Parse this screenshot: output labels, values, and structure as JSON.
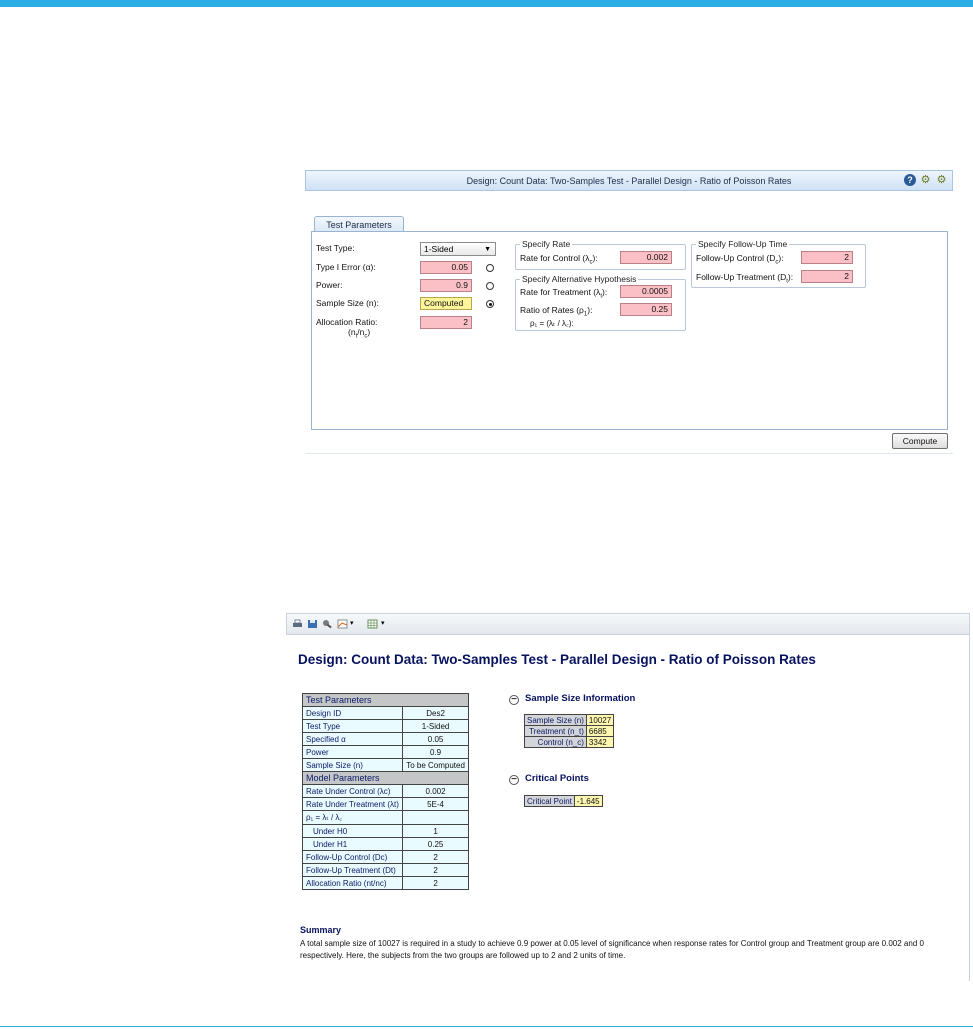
{
  "dialog": {
    "title": "Design: Count Data: Two-Samples Test - Parallel Design - Ratio of Poisson Rates",
    "tab": "Test Parameters",
    "test_type": {
      "label": "Test Type:",
      "value": "1-Sided"
    },
    "type1_error": {
      "label": "Type I Error (α):",
      "value": "0.05"
    },
    "power": {
      "label": "Power:",
      "value": "0.9"
    },
    "sample_size": {
      "label": "Sample Size (n):",
      "value": "Computed",
      "selected_radio": "sample_size"
    },
    "allocation": {
      "label": "Allocation Ratio:",
      "label2": "(n",
      "sub_t": "t",
      "slash": "/n",
      "sub_c": "c",
      "close": ")",
      "value": "2"
    },
    "specify_rate": {
      "title": "Specify Rate",
      "control_label": "Rate for Control (λ",
      "control_sub": "c",
      "control_close": "):",
      "control_value": "0.002"
    },
    "alt_hyp": {
      "title": "Specify Alternative Hypothesis",
      "treatment_label": "Rate for Treatment (λ",
      "treatment_sub": "t",
      "treatment_close": "):",
      "treatment_value": "0.0005",
      "ratio_label": "Ratio of Rates (ρ",
      "ratio_sub": "1",
      "ratio_close": "):",
      "ratio_value": "0.25",
      "formula": "ρ₁ = (λₜ / λ꜀):"
    },
    "followup": {
      "title": "Specify Follow-Up Time",
      "control_label": "Follow-Up Control (D",
      "control_sub": "c",
      "control_close": "):",
      "control_value": "2",
      "treatment_label": "Follow-Up Treatment (D",
      "treatment_sub": "t",
      "treatment_close": "):",
      "treatment_value": "2"
    },
    "compute_button": "Compute"
  },
  "report": {
    "title": "Design: Count Data: Two-Samples Test - Parallel Design - Ratio of Poisson Rates",
    "test_parameters": {
      "header": "Test Parameters",
      "rows": [
        {
          "k": "Design ID",
          "v": "Des2"
        },
        {
          "k": "Test Type",
          "v": "1-Sided"
        },
        {
          "k": "Specified α",
          "v": "0.05"
        },
        {
          "k": "Power",
          "v": "0.9"
        },
        {
          "k": "Sample Size (n)",
          "v": "To be Computed"
        }
      ]
    },
    "model_parameters": {
      "header": "Model Parameters",
      "rows": [
        {
          "k": "Rate Under Control (λc)",
          "v": "0.002"
        },
        {
          "k": "Rate Under Treatment (λt)",
          "v": "5E-4"
        },
        {
          "k": "ρ₁ = λₜ / λ꜀",
          "v": ""
        },
        {
          "k": "Under H0",
          "v": "1",
          "indent": true
        },
        {
          "k": "Under H1",
          "v": "0.25",
          "indent": true
        },
        {
          "k": "Follow-Up Control (Dc)",
          "v": "2"
        },
        {
          "k": "Follow-Up Treatment (Dt)",
          "v": "2"
        },
        {
          "k": "Allocation Ratio (nt/nc)",
          "v": "2"
        }
      ]
    },
    "sample_size_info": {
      "title": "Sample Size Information",
      "rows": [
        {
          "k": "Sample Size (n)",
          "v": "10027"
        },
        {
          "k": "Treatment (n_t)",
          "v": "6685"
        },
        {
          "k": "Control (n_c)",
          "v": "3342"
        }
      ]
    },
    "critical_points": {
      "title": "Critical Points",
      "rows": [
        {
          "k": "Critical Point",
          "v": "-1.645"
        }
      ]
    },
    "summary": {
      "title": "Summary",
      "text": "A total sample size of 10027 is required in a study to achieve 0.9 power at 0.05 level of significance when response rates for Control group and Treatment group are 0.002 and 0 respectively. Here, the subjects from the two groups are followed up to 2 and 2 units of time."
    }
  }
}
